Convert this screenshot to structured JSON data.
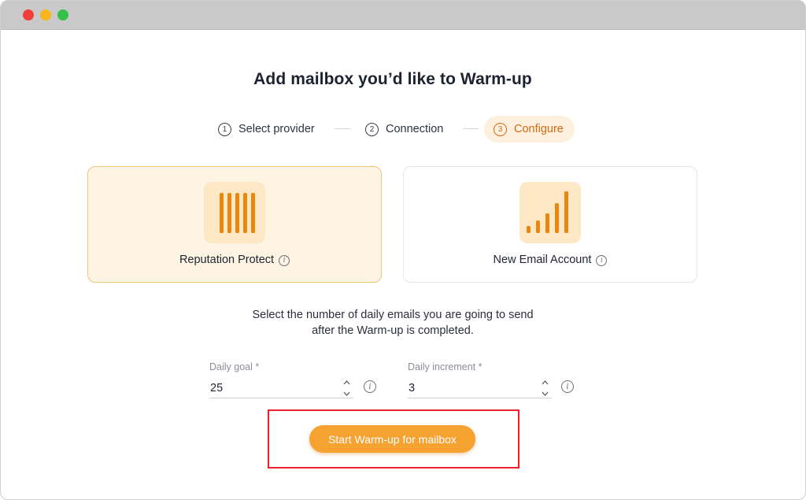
{
  "page": {
    "title": "Add mailbox you’d like to Warm-up"
  },
  "stepper": {
    "steps": [
      {
        "number": "1",
        "label": "Select provider",
        "state": "complete"
      },
      {
        "number": "2",
        "label": "Connection",
        "state": "complete"
      },
      {
        "number": "3",
        "label": "Configure",
        "state": "active"
      }
    ]
  },
  "modes": [
    {
      "label": "Reputation Protect",
      "icon": "vertical-bars-icon",
      "selected": true
    },
    {
      "label": "New Email Account",
      "icon": "signal-bars-icon",
      "selected": false
    }
  ],
  "helper": {
    "line1": "Select the number of daily emails you are going to send",
    "line2": "after the Warm-up is completed."
  },
  "fields": {
    "daily_goal": {
      "label": "Daily goal *",
      "value": "25"
    },
    "daily_increment": {
      "label": "Daily increment *",
      "value": "3"
    }
  },
  "actions": {
    "start_label": "Start Warm-up for mailbox"
  },
  "colors": {
    "accent": "#f5a230",
    "accent_dark": "#d56a14",
    "selected_card_bg": "#fef4e3",
    "highlight_border": "#e8222a"
  }
}
